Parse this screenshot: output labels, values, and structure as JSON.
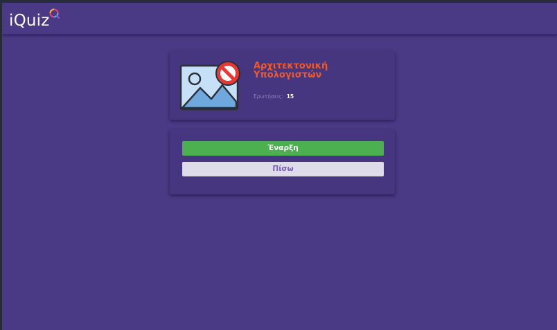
{
  "app": {
    "logo_text": "iQuiz"
  },
  "quiz": {
    "title_line1": "Αρχιτεκτονική",
    "title_line2": "Υπολογιστών",
    "questions_label": "Ερωτήσεις:",
    "questions_count": "15",
    "image_icon": "image-placeholder-icon",
    "no_entry_icon": "prohibited-icon"
  },
  "actions": {
    "start_label": "Έναρξη",
    "back_label": "Πίσω"
  },
  "colors": {
    "background": "#4a3984",
    "card": "#463680",
    "title": "#f2592a",
    "start_button": "#4caf50",
    "back_button": "#dfdcea",
    "back_text": "#7a5bbf"
  }
}
